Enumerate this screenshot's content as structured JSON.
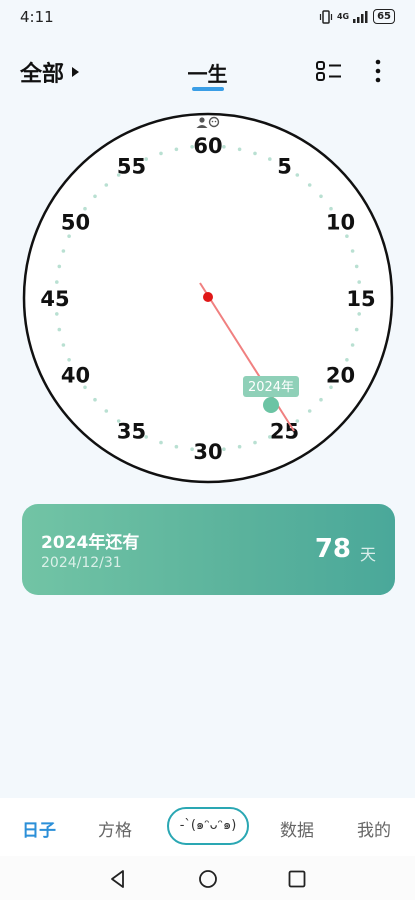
{
  "status": {
    "time": "4:11",
    "network": "4G",
    "battery": "65"
  },
  "header": {
    "filter_label": "全部",
    "title": "一生"
  },
  "clock": {
    "labels": [
      "60",
      "5",
      "10",
      "15",
      "20",
      "25",
      "30",
      "35",
      "40",
      "45",
      "50",
      "55"
    ],
    "marker_label": "2024年",
    "top_icons": [
      "person-icon",
      "face-icon"
    ]
  },
  "card": {
    "title": "2024年还有",
    "date": "2024/12/31",
    "count": "78",
    "unit": "天"
  },
  "nav": {
    "items": [
      "日子",
      "方格",
      "数据",
      "我的"
    ],
    "center_label": "-`(๑ᵔᴗᵔ๑)",
    "active_index": 0
  },
  "colors": {
    "accent_blue": "#2b8fd8",
    "card_green": "#5ab29c",
    "hand_red": "#f08080",
    "marker_green": "#6cc4a4"
  }
}
